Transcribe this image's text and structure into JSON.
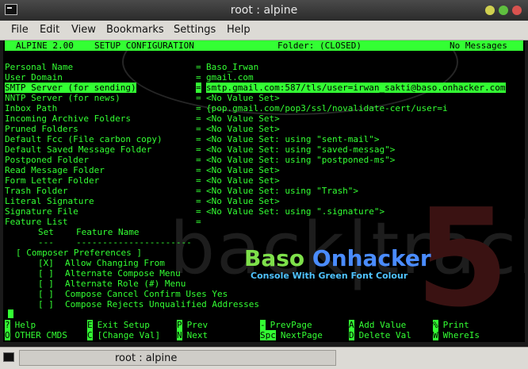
{
  "window": {
    "title": "root : alpine"
  },
  "menu": {
    "items": [
      "File",
      "Edit",
      "View",
      "Bookmarks",
      "Settings",
      "Help"
    ]
  },
  "header": {
    "app": "ALPINE 2.00",
    "screen": "SETUP CONFIGURATION",
    "folder": "Folder: (CLOSED)",
    "messages": "No Messages"
  },
  "config": [
    {
      "name": "Personal Name",
      "value": "Baso_Irwan"
    },
    {
      "name": "User Domain",
      "value": "gmail.com"
    },
    {
      "name": "SMTP Server (for sending)",
      "value": "smtp.gmail.com:587/tls/user=irwan_sakti@baso.onhacker.com",
      "selected": true
    },
    {
      "name": "NNTP Server (for news)",
      "value": "<No Value Set>"
    },
    {
      "name": "Inbox Path",
      "value": "{pop.gmail.com/pop3/ssl/novalidate-cert/user=i"
    },
    {
      "name": "Incoming Archive Folders",
      "value": "<No Value Set>"
    },
    {
      "name": "Pruned Folders",
      "value": "<No Value Set>"
    },
    {
      "name": "Default Fcc (File carbon copy)",
      "value": "<No Value Set: using \"sent-mail\">"
    },
    {
      "name": "Default Saved Message Folder",
      "value": "<No Value Set: using \"saved-messag\">"
    },
    {
      "name": "Postponed Folder",
      "value": "<No Value Set: using \"postponed-ms\">"
    },
    {
      "name": "Read Message Folder",
      "value": "<No Value Set>"
    },
    {
      "name": "Form Letter Folder",
      "value": "<No Value Set>"
    },
    {
      "name": "Trash Folder",
      "value": "<No Value Set: using \"Trash\">"
    },
    {
      "name": "Literal Signature",
      "value": "<No Value Set>"
    },
    {
      "name": "Signature File",
      "value": "<No Value Set: using \".signature\">"
    },
    {
      "name": "Feature List",
      "value": ""
    }
  ],
  "features": {
    "col_set": "Set",
    "col_name": "Feature Name",
    "sep_set": "---",
    "sep_name": "----------------------",
    "group": "[ Composer Preferences ]",
    "items": [
      {
        "mark": "[X]",
        "label": "Allow Changing From"
      },
      {
        "mark": "[ ]",
        "label": "Alternate Compose Menu"
      },
      {
        "mark": "[ ]",
        "label": "Alternate Role (#) Menu"
      },
      {
        "mark": "[ ]",
        "label": "Compose Cancel Confirm Uses Yes"
      },
      {
        "mark": "[ ]",
        "label": "Compose Rejects Unqualified Addresses"
      }
    ]
  },
  "watermark": {
    "brand1": "Baso",
    "brand2": "Onhacker",
    "tagline": "Console With Green Font Colour",
    "bg_text": "back|track",
    "bg_num": "5"
  },
  "keys": [
    [
      {
        "k": "?",
        "l": "Help"
      },
      {
        "k": "E",
        "l": "Exit Setup"
      },
      {
        "k": "P",
        "l": "Prev"
      },
      {
        "k": "-",
        "l": "PrevPage"
      },
      {
        "k": "A",
        "l": "Add Value"
      },
      {
        "k": "%",
        "l": "Print"
      }
    ],
    [
      {
        "k": "O",
        "l": "OTHER CMDS"
      },
      {
        "k": "C",
        "l": "[Change Val]"
      },
      {
        "k": "N",
        "l": "Next"
      },
      {
        "k": "Spc",
        "l": "NextPage"
      },
      {
        "k": "D",
        "l": "Delete Val"
      },
      {
        "k": "W",
        "l": "WhereIs"
      }
    ]
  ],
  "taskbar": {
    "task_label": "root : alpine"
  }
}
